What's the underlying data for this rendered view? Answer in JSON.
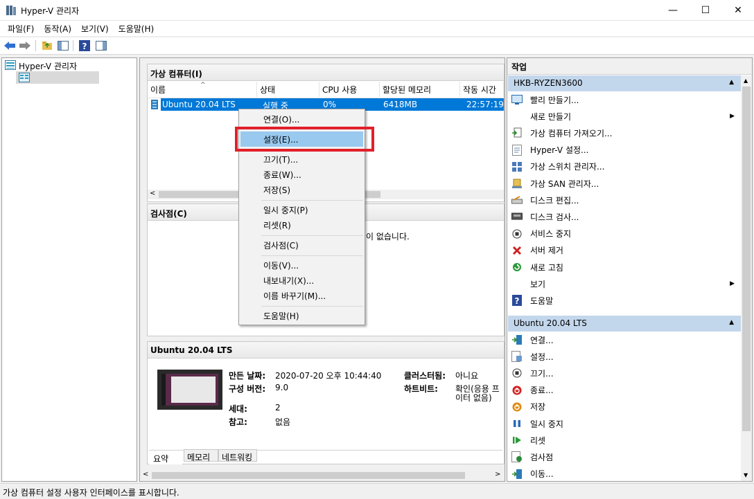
{
  "window": {
    "title": "Hyper-V 관리자",
    "minimize": "—",
    "maximize": "☐",
    "close": "✕"
  },
  "menubar": [
    "파일(F)",
    "동작(A)",
    "보기(V)",
    "도움말(H)"
  ],
  "tree": {
    "root": "Hyper-V 관리자",
    "server": ""
  },
  "vm_panel": {
    "title": "가상 컴퓨터(I)",
    "columns": [
      "이름",
      "상태",
      "CPU 사용",
      "할당된 메모리",
      "작동 시간"
    ],
    "rows": [
      {
        "name": "Ubuntu 20.04 LTS",
        "state": "실행 중",
        "cpu": "0%",
        "memory": "6418MB",
        "uptime": "22:57:19"
      }
    ]
  },
  "checkpoint_panel": {
    "title": "검사점(C)",
    "empty_text": "이 없습니다."
  },
  "context_menu": {
    "items": [
      "연결(O)...",
      "설정(E)...",
      "끄기(T)...",
      "종료(W)...",
      "저장(S)",
      "일시 중지(P)",
      "리셋(R)",
      "검사점(C)",
      "이동(V)...",
      "내보내기(X)...",
      "이름 바꾸기(M)...",
      "도움말(H)"
    ],
    "highlighted": "설정(E)...",
    "highlight_color": "#99c9ef",
    "callout_color": "#e0202a"
  },
  "details_panel": {
    "title": "Ubuntu 20.04 LTS",
    "created_label": "만든 날짜:",
    "created_value": "2020-07-20 오후 10:44:40",
    "config_label": "구성 버전:",
    "config_value": "9.0",
    "gen_label": "세대:",
    "gen_value": "2",
    "notes_label": "참고:",
    "notes_value": "없음",
    "clustered_label": "클러스터됨:",
    "clustered_value": "아니요",
    "heartbeat_label": "하트비트:",
    "heartbeat_value1": "확인(응용 프",
    "heartbeat_value2": "이터 없음)",
    "tabs": [
      "요약",
      "메모리",
      "네트워킹"
    ]
  },
  "actions": {
    "header": "작업",
    "server_group": "HKB-RYZEN3600",
    "server_actions": [
      {
        "label": "빨리 만들기...",
        "icon": "quick-create-icon"
      },
      {
        "label": "새로 만들기",
        "icon": "",
        "submenu": true
      },
      {
        "label": "가상 컴퓨터 가져오기...",
        "icon": "import-icon"
      },
      {
        "label": "Hyper-V 설정...",
        "icon": "settings-page-icon"
      },
      {
        "label": "가상 스위치 관리자...",
        "icon": "switch-icon"
      },
      {
        "label": "가상 SAN 관리자...",
        "icon": "san-icon"
      },
      {
        "label": "디스크 편집...",
        "icon": "edit-disk-icon"
      },
      {
        "label": "디스크 검사...",
        "icon": "inspect-disk-icon"
      },
      {
        "label": "서비스 중지",
        "icon": "stop-icon"
      },
      {
        "label": "서버 제거",
        "icon": "remove-icon"
      },
      {
        "label": "새로 고침",
        "icon": "refresh-icon"
      },
      {
        "label": "보기",
        "icon": "",
        "submenu": true
      },
      {
        "label": "도움말",
        "icon": "help-icon"
      }
    ],
    "vm_group": "Ubuntu 20.04 LTS",
    "vm_actions": [
      {
        "label": "연결...",
        "icon": "connect-icon"
      },
      {
        "label": "설정...",
        "icon": "settings-icon"
      },
      {
        "label": "끄기...",
        "icon": "turn-off-icon"
      },
      {
        "label": "종료...",
        "icon": "shutdown-icon"
      },
      {
        "label": "저장",
        "icon": "save-icon"
      },
      {
        "label": "일시 중지",
        "icon": "pause-icon"
      },
      {
        "label": "리셋",
        "icon": "reset-icon"
      },
      {
        "label": "검사점",
        "icon": "checkpoint-icon"
      },
      {
        "label": "이동...",
        "icon": "move-icon"
      }
    ]
  },
  "statusbar": "가상 컴퓨터 설정 사용자 인터페이스를 표시합니다."
}
